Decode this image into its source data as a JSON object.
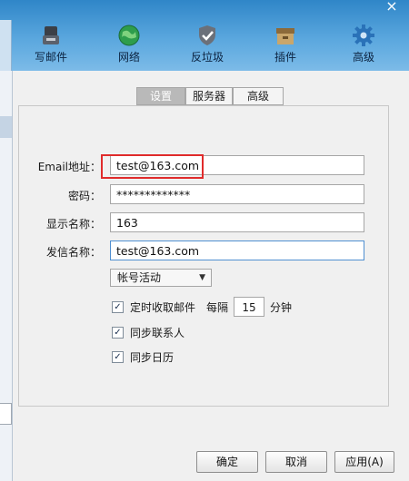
{
  "toolbar": {
    "items": [
      {
        "label": "写邮件",
        "icon": "write-mail-icon"
      },
      {
        "label": "网络",
        "icon": "globe-icon"
      },
      {
        "label": "反垃圾",
        "icon": "shield-icon"
      },
      {
        "label": "插件",
        "icon": "box-icon"
      },
      {
        "label": "高级",
        "icon": "gear-icon"
      }
    ],
    "close": "×"
  },
  "tabs": [
    {
      "label": "设置",
      "active": true
    },
    {
      "label": "服务器",
      "active": false
    },
    {
      "label": "高级",
      "active": false
    }
  ],
  "form": {
    "email_label": "Email地址：",
    "email_value": "test@163.com",
    "password_label": "密码：",
    "password_value": "*************",
    "display_label": "显示名称：",
    "display_value": "163",
    "sender_label": "发信名称：",
    "sender_value": "test@163.com",
    "status_select": "帐号活动",
    "check_timer_label": "定时收取邮件",
    "every_label": "每隔",
    "interval_value": "15",
    "minutes_label": "分钟",
    "sync_contacts_label": "同步联系人",
    "sync_calendar_label": "同步日历"
  },
  "buttons": {
    "ok": "确定",
    "cancel": "取消",
    "apply": "应用(A)"
  },
  "colors": {
    "toolbar_top": "#2f86c8",
    "highlight": "#e02b2b"
  }
}
